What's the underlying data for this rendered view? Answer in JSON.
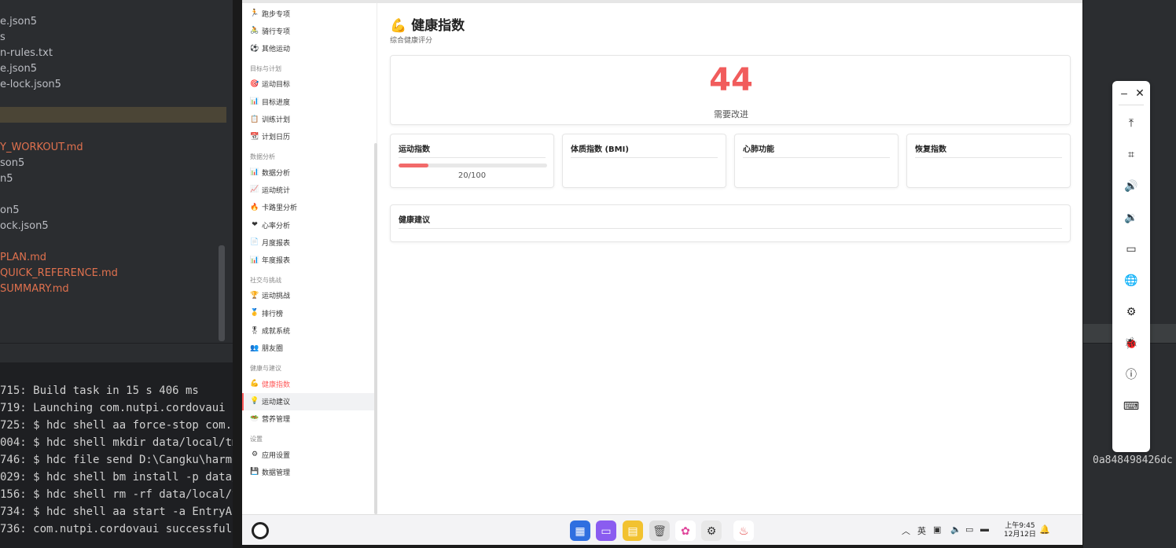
{
  "ide": {
    "files": [
      {
        "text": "e.json5",
        "red": false
      },
      {
        "text": "s",
        "red": false
      },
      {
        "text": "n-rules.txt",
        "red": false
      },
      {
        "text": "e.json5",
        "red": false
      },
      {
        "text": "e-lock.json5",
        "red": false
      },
      {
        "text": "Y_WORKOUT.md",
        "red": true
      },
      {
        "text": "son5",
        "red": false
      },
      {
        "text": "n5",
        "red": false
      },
      {
        "text": "on5",
        "red": false
      },
      {
        "text": "ock.json5",
        "red": false
      },
      {
        "text": "PLAN.md",
        "red": true
      },
      {
        "text": "QUICK_REFERENCE.md",
        "red": true
      },
      {
        "text": "SUMMARY.md",
        "red": true
      }
    ],
    "terminal": [
      "715: Build task in 15 s 406 ms",
      "719: Launching com.nutpi.cordovaui",
      "725: $ hdc shell aa force-stop com.nu",
      "004: $ hdc shell mkdir data/local/tmp",
      "746: $ hdc file send D:\\Cangku\\harmon",
      "029: $ hdc shell bm install -p data/l",
      "156: $ hdc shell rm -rf data/local/tm",
      "734: $ hdc shell aa start -a EntryAbi",
      "736: com.nutpi.cordovaui successfully"
    ],
    "right_terminal_text": "0a848498426dc"
  },
  "sidebar": {
    "items_top": [
      {
        "icon": "🏃",
        "label": "跑步专项"
      },
      {
        "icon": "🚴",
        "label": "骑行专项"
      },
      {
        "icon": "⚽",
        "label": "其他运动"
      }
    ],
    "sections": [
      {
        "title": "目标与计划",
        "items": [
          {
            "icon": "🎯",
            "label": "运动目标"
          },
          {
            "icon": "📊",
            "label": "目标进度"
          },
          {
            "icon": "📋",
            "label": "训练计划"
          },
          {
            "icon": "📆",
            "label": "计划日历"
          }
        ]
      },
      {
        "title": "数据分析",
        "items": [
          {
            "icon": "📊",
            "label": "数据分析"
          },
          {
            "icon": "📈",
            "label": "运动统计"
          },
          {
            "icon": "🔥",
            "label": "卡路里分析"
          },
          {
            "icon": "❤",
            "label": "心率分析"
          },
          {
            "icon": "📄",
            "label": "月度报表"
          },
          {
            "icon": "📊",
            "label": "年度报表"
          }
        ]
      },
      {
        "title": "社交与挑战",
        "items": [
          {
            "icon": "🏆",
            "label": "运动挑战"
          },
          {
            "icon": "🥇",
            "label": "排行榜"
          },
          {
            "icon": "🎖",
            "label": "成就系统"
          },
          {
            "icon": "👥",
            "label": "朋友圈"
          }
        ]
      },
      {
        "title": "健康与建议",
        "items": [
          {
            "icon": "💪",
            "label": "健康指数",
            "active": true
          },
          {
            "icon": "💡",
            "label": "运动建议"
          },
          {
            "icon": "🥗",
            "label": "营养管理"
          }
        ]
      },
      {
        "title": "设置",
        "items": [
          {
            "icon": "⚙",
            "label": "应用设置"
          },
          {
            "icon": "💾",
            "label": "数据管理"
          }
        ]
      }
    ]
  },
  "page": {
    "title_icon": "💪",
    "title": "健康指数",
    "subtitle": "综合健康评分",
    "score": "44",
    "score_label": "需要改进",
    "metrics": [
      {
        "title": "运动指数",
        "value": "20/100",
        "progress": 0.2
      },
      {
        "title": "体质指数 (BMI)",
        "value": ""
      },
      {
        "title": "心肺功能",
        "value": ""
      },
      {
        "title": "恢复指数",
        "value": ""
      }
    ],
    "advice_title": "健康建议"
  },
  "taskbar": {
    "time": "上午9:45",
    "date": "12月12日",
    "ime": "英"
  },
  "tools": [
    "minimize-icon",
    "close-icon",
    "top-icon",
    "crop-icon",
    "volume-up-icon",
    "volume-down-icon",
    "battery-icon",
    "globe-icon",
    "gear-icon",
    "bug-icon",
    "info-icon",
    "keyboard-icon"
  ],
  "colors": {
    "accent": "#f15c5c",
    "ide_bg": "#2b2d30",
    "terminal_bg": "#1e1f22"
  }
}
